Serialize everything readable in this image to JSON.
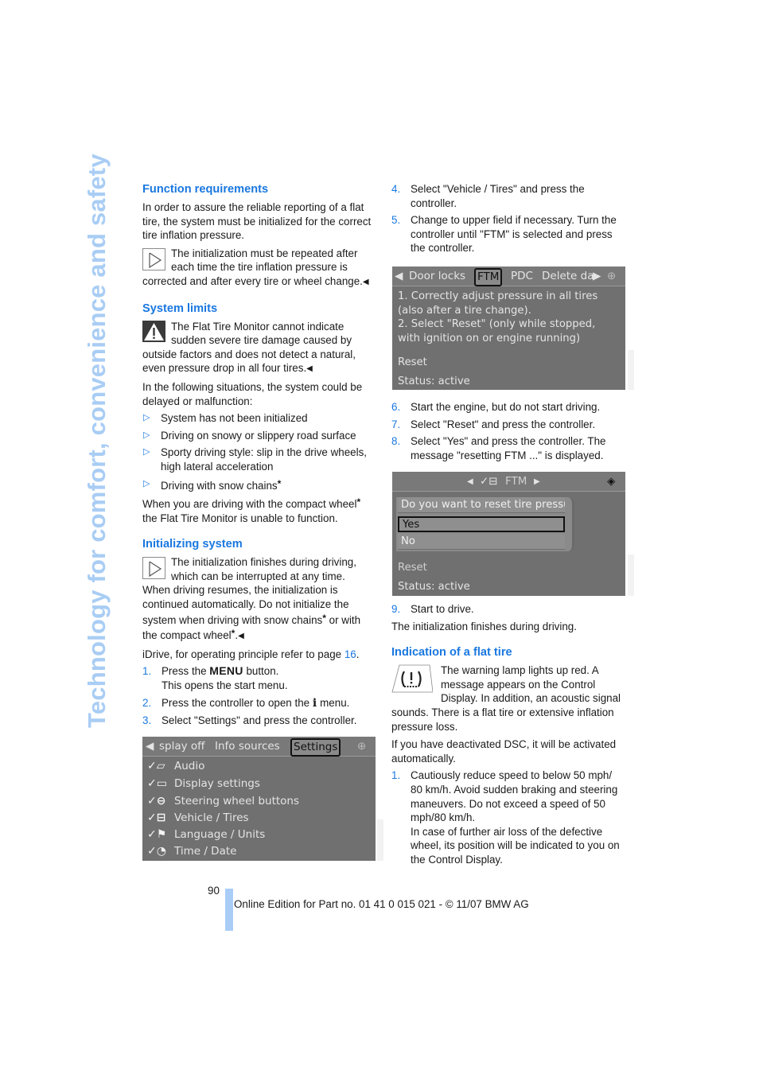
{
  "side_title": "Technology for comfort, convenience and safety",
  "left_column": {
    "function_requirements": {
      "heading": "Function requirements",
      "intro": "In order to assure the reliable reporting of a flat tire, the system must be initialized for the correct tire inflation pressure.",
      "note": "The initialization must be repeated after each time the tire inflation pressure is corrected and after every tire or wheel change."
    },
    "system_limits": {
      "heading": "System limits",
      "warning": "The Flat Tire Monitor cannot indicate sudden severe tire damage caused by outside factors and does not detect a natural, even pressure drop in all four tires.",
      "situations_intro": "In the following situations, the system could be delayed or malfunction:",
      "situations": [
        "System has not been initialized",
        "Driving on snowy or slippery road surface",
        "Sporty driving style: slip in the drive wheels, high lateral acceleration",
        "Driving with snow chains"
      ],
      "compact_wheel_a": "When you are driving with the compact wheel",
      "compact_wheel_b": "the Flat Tire Monitor is unable to function."
    },
    "initializing": {
      "heading": "Initializing system",
      "note_a": "The initialization finishes during driving, which can be interrupted at any time. When driving resumes, the initialization is continued automatically. Do not initialize the system when driving with snow chains",
      "note_b": " or with the compact wheel",
      "idrive_text": "iDrive, for operating principle refer to page ",
      "idrive_page": "16",
      "steps": [
        {
          "num": "1.",
          "pre": "Press the ",
          "key": "MENU",
          "post": " button.",
          "sub": "This opens the start menu."
        },
        {
          "num": "2.",
          "pre": "Press the controller to open the ",
          "key": "i",
          "post": " menu."
        },
        {
          "num": "3.",
          "text": "Select \"Settings\" and press the controller."
        }
      ]
    },
    "screen_settings": {
      "tabs": [
        "splay off",
        "Info sources",
        "Settings"
      ],
      "selected_tab": "Settings",
      "items": [
        "Audio",
        "Display settings",
        "Steering wheel buttons",
        "Vehicle / Tires",
        "Language / Units",
        "Time / Date"
      ]
    }
  },
  "right_column": {
    "steps_a": [
      {
        "num": "4.",
        "text": "Select \"Vehicle / Tires\" and press the controller."
      },
      {
        "num": "5.",
        "text": "Change to upper field if necessary. Turn the controller until \"FTM\" is selected and press the controller."
      }
    ],
    "screen_ftm": {
      "tabs": [
        "Door locks",
        "FTM",
        "PDC",
        "Delete da"
      ],
      "selected_tab": "FTM",
      "lines": [
        "1. Correctly adjust pressure in all tires",
        "(also after a tire change).",
        "2. Select \"Reset\" (only while stopped,",
        "with ignition on or engine running)"
      ],
      "reset": "Reset",
      "status": "Status: active"
    },
    "steps_b": [
      {
        "num": "6.",
        "text": "Start the engine, but do not start driving."
      },
      {
        "num": "7.",
        "text": "Select \"Reset\" and press the controller."
      },
      {
        "num": "8.",
        "text": "Select \"Yes\" and press the controller. The message \"resetting FTM ...\" is displayed."
      }
    ],
    "screen_reset": {
      "title": "FTM",
      "question": "Do you want to reset tire pressur",
      "options": [
        "Yes",
        "No"
      ],
      "selected": "Yes",
      "reset": "Reset",
      "status": "Status:  active"
    },
    "steps_c": [
      {
        "num": "9.",
        "text": "Start to drive."
      }
    ],
    "finish_text": "The initialization finishes during driving.",
    "flat_tire": {
      "heading": "Indication of a flat tire",
      "text": "The warning lamp lights up red. A message appears on the Control Display. In addition, an acoustic signal sounds. There is a flat tire or extensive inflation pressure loss.",
      "dsc_text": "If you have deactivated DSC, it will be activated automatically.",
      "steps": [
        {
          "num": "1.",
          "text": "Cautiously reduce speed to below 50 mph/ 80 km/h. Avoid sudden braking and steering maneuvers. Do not exceed a speed of 50 mph/80 km/h.",
          "sub": "In case of further air loss of the defective wheel, its position will be indicated to you on the Control Display."
        }
      ]
    }
  },
  "footer": {
    "page_number": "90",
    "text": "Online Edition for Part no. 01 41 0 015 021 - © 11/07 BMW AG"
  },
  "symbols": {
    "end_mark": "◀",
    "bullet": "▷",
    "star": "*"
  }
}
